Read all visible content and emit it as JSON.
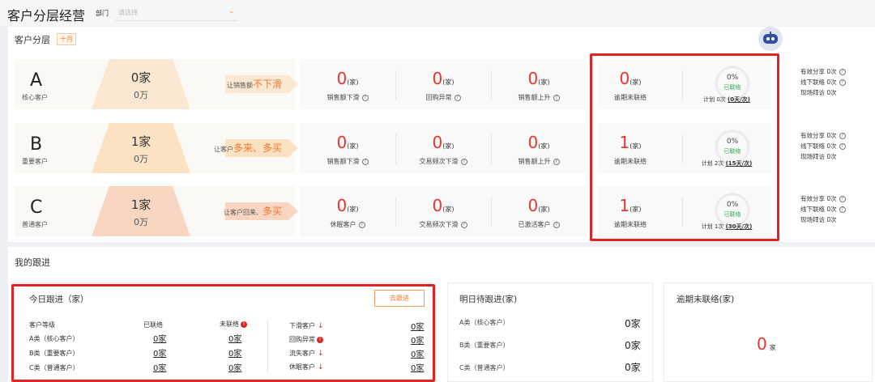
{
  "app": {
    "title": "客户分层经营",
    "dept_label": "部门",
    "dept_placeholder": "请选择"
  },
  "tiers_section": {
    "title": "客户分层",
    "period_badge": "十月"
  },
  "tiers": [
    {
      "letter": "A",
      "name": "核心客户",
      "count": "0家",
      "amount": "0万",
      "goal_prefix": "让销售额",
      "goal_highlight": "不下滑",
      "funnel_color": "#fbe8d2",
      "metrics": [
        {
          "value": "0",
          "unit": "(家)",
          "label": "销售额下滑"
        },
        {
          "value": "0",
          "unit": "(家)",
          "label": "回购异常"
        },
        {
          "value": "0",
          "unit": "(家)",
          "label": "销售额上升"
        }
      ],
      "overdue": {
        "value": "0",
        "unit": "(家)",
        "label": "逾期未联络",
        "percent": "0%",
        "status": "已联络",
        "plan_prefix": "计划 0次",
        "plan_link": "(0天/次)"
      },
      "stats": [
        "有效分享 0次",
        "线下联络 0次",
        "现场拜访 0次"
      ]
    },
    {
      "letter": "B",
      "name": "重要客户",
      "count": "1家",
      "amount": "0万",
      "goal_prefix": "让客户",
      "goal_highlight": "多来、多买",
      "funnel_color": "#fbe2c2",
      "metrics": [
        {
          "value": "0",
          "unit": "(家)",
          "label": "销售额下滑"
        },
        {
          "value": "0",
          "unit": "(家)",
          "label": "交易频次下滑"
        },
        {
          "value": "0",
          "unit": "(家)",
          "label": "销售额上升"
        }
      ],
      "overdue": {
        "value": "1",
        "unit": "(家)",
        "label": "逾期未联络",
        "percent": "0%",
        "status": "已联络",
        "plan_prefix": "计划 2次",
        "plan_link": "(15天/次)"
      },
      "stats": [
        "有效分享 0次",
        "线下联络 0次",
        "现场拜访 0次"
      ]
    },
    {
      "letter": "C",
      "name": "普通客户",
      "count": "1家",
      "amount": "0万",
      "goal_prefix": "让客户回来、",
      "goal_highlight": "多买",
      "funnel_color": "#f9d6c2",
      "metrics": [
        {
          "value": "0",
          "unit": "(家)",
          "label": "休眠客户"
        },
        {
          "value": "0",
          "unit": "(家)",
          "label": "交易频次下滑"
        },
        {
          "value": "0",
          "unit": "(家)",
          "label": "已激活客户"
        }
      ],
      "overdue": {
        "value": "1",
        "unit": "(家)",
        "label": "逾期未联络",
        "percent": "0%",
        "status": "已联络",
        "plan_prefix": "计划 1次",
        "plan_link": "(30天/次)"
      },
      "stats": [
        "有效分享 0次",
        "线下联络 0次",
        "现场拜访 0次"
      ]
    }
  ],
  "followup_section": {
    "title": "我的跟进"
  },
  "today": {
    "title": "今日跟进（家）",
    "button": "去跟进",
    "headers": {
      "level": "客户等级",
      "contacted": "已联络",
      "uncontacted": "未联络"
    },
    "rows": [
      {
        "level": "A类（核心客户）",
        "contacted": "0家",
        "uncontacted": "0家"
      },
      {
        "level": "B类（重要客户）",
        "contacted": "0家",
        "uncontacted": "0家"
      },
      {
        "level": "C类（普通客户）",
        "contacted": "0家",
        "uncontacted": "0家"
      }
    ],
    "categories": [
      {
        "label": "下滑客户",
        "value": "0家",
        "marker": "down"
      },
      {
        "label": "回购异常",
        "value": "0家",
        "marker": "alert"
      },
      {
        "label": "流失客户",
        "value": "0家",
        "marker": "down"
      },
      {
        "label": "休眠客户",
        "value": "0家",
        "marker": "down"
      }
    ]
  },
  "tomorrow": {
    "title": "明日待跟进(家)",
    "rows": [
      {
        "label": "A类（核心客户）",
        "value": "0家"
      },
      {
        "label": "B类（重要客户）",
        "value": "0家"
      },
      {
        "label": "C类（普通客户）",
        "value": "0家"
      }
    ]
  },
  "overdue_panel": {
    "title": "逾期未联络(家)",
    "value": "0",
    "unit": "家"
  },
  "colors": {
    "accent": "#f47a2e",
    "alert": "#e9362c",
    "highlight_box": "#e02424",
    "success": "#2aa84a"
  }
}
